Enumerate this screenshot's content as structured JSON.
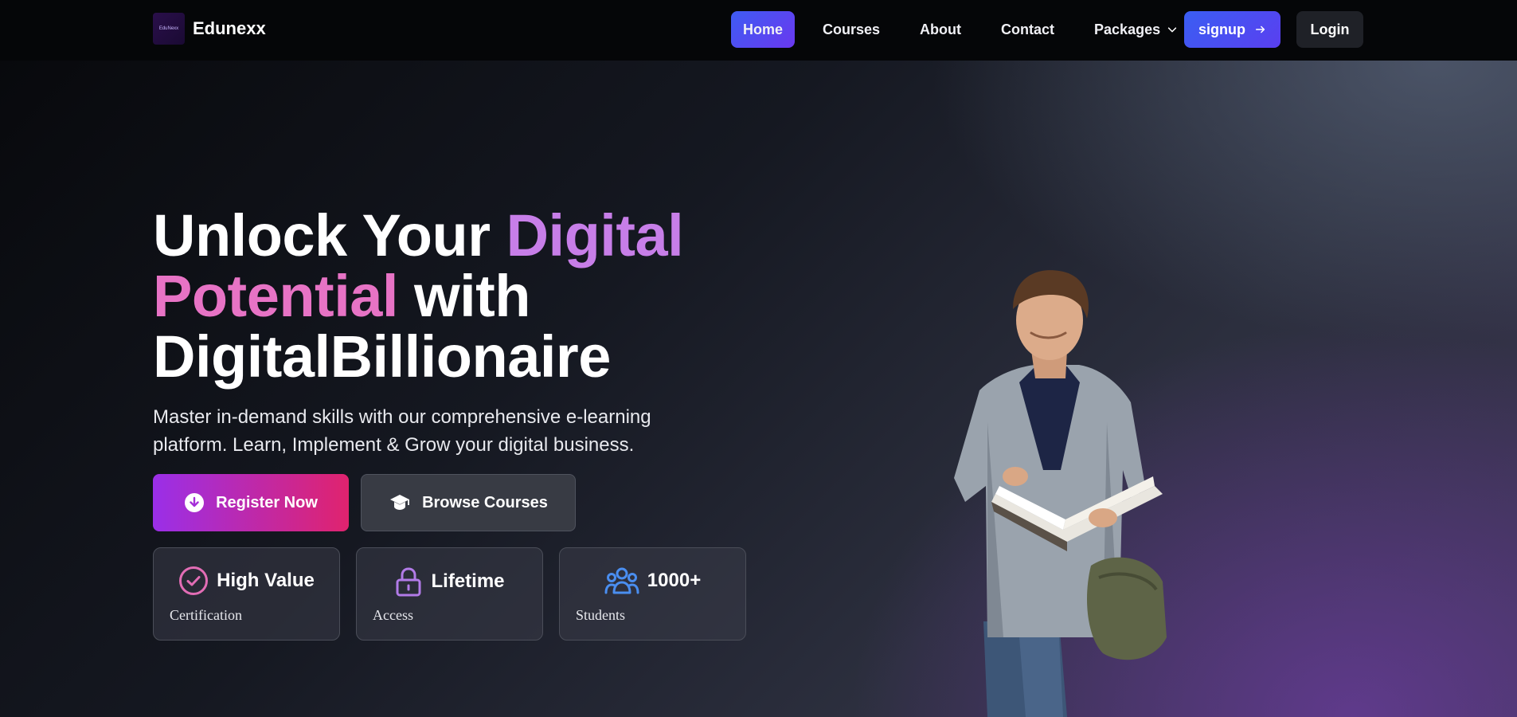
{
  "brand": {
    "logo_text": "EduNexx",
    "name": "Edunexx"
  },
  "nav": {
    "items": [
      {
        "label": "Home",
        "active": true
      },
      {
        "label": "Courses",
        "active": false
      },
      {
        "label": "About",
        "active": false
      },
      {
        "label": "Contact",
        "active": false
      },
      {
        "label": "Packages",
        "active": false,
        "icon": "chevron-down-icon"
      }
    ],
    "signup_label": "signup",
    "login_label": "Login"
  },
  "hero": {
    "title_part1": "Unlock Your ",
    "title_highlight1": "Digital",
    "title_highlight2": "Potential",
    "title_part2": " with",
    "title_part3": "DigitalBillionaire",
    "subtitle": "Master in-demand skills with our comprehensive e-learning platform. Learn, Implement & Grow your digital business.",
    "register_label": "Register Now",
    "browse_label": "Browse Courses"
  },
  "stats": [
    {
      "value": "High Value",
      "label": "Certification",
      "icon": "check-circle-icon",
      "color": "#e26db5"
    },
    {
      "value": "Lifetime",
      "label": "Access",
      "icon": "lock-icon",
      "color": "#b27be8"
    },
    {
      "value": "1000+",
      "label": "Students",
      "icon": "users-icon",
      "color": "#4a8ef0"
    }
  ],
  "colors": {
    "accent_blue": "#3e5cf2",
    "accent_purple": "#c77ee8",
    "accent_pink": "#e773c5",
    "register_gradient_start": "#9a2fe8",
    "register_gradient_end": "#e0236e"
  }
}
